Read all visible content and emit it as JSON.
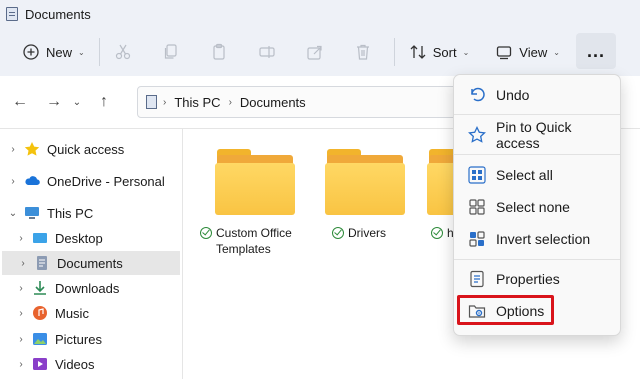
{
  "window": {
    "title": "Documents"
  },
  "toolbar": {
    "new_label": "New",
    "sort_label": "Sort",
    "view_label": "View",
    "more_label": "..."
  },
  "address": {
    "crumbs": [
      "This PC",
      "Documents"
    ]
  },
  "nav_pane": {
    "items": [
      {
        "label": "Quick access",
        "icon": "star-icon"
      },
      {
        "label": "OneDrive - Personal",
        "icon": "cloud-icon"
      },
      {
        "label": "This PC",
        "icon": "computer-icon"
      },
      {
        "label": "Desktop",
        "icon": "desktop-icon"
      },
      {
        "label": "Documents",
        "icon": "documents-icon"
      },
      {
        "label": "Downloads",
        "icon": "download-icon"
      },
      {
        "label": "Music",
        "icon": "music-icon"
      },
      {
        "label": "Pictures",
        "icon": "pictures-icon"
      },
      {
        "label": "Videos",
        "icon": "videos-icon"
      }
    ],
    "selected": "Documents"
  },
  "folders": [
    {
      "name_line1": "Custom Office",
      "name_line2": "Templates"
    },
    {
      "name_line1": "Drivers",
      "name_line2": ""
    },
    {
      "name_line1": "h",
      "name_line2": ""
    }
  ],
  "menu": {
    "items": [
      {
        "label": "Undo",
        "icon": "undo-icon"
      },
      {
        "label": "Pin to Quick access",
        "icon": "pin-icon"
      },
      {
        "label": "Select all",
        "icon": "select-all-icon"
      },
      {
        "label": "Select none",
        "icon": "select-none-icon"
      },
      {
        "label": "Invert selection",
        "icon": "invert-selection-icon"
      },
      {
        "label": "Properties",
        "icon": "properties-icon"
      },
      {
        "label": "Options",
        "icon": "options-icon"
      }
    ],
    "highlighted": "Options"
  },
  "colors": {
    "accent": "#2a6fc9",
    "highlight": "#d9141b",
    "toolbar_bg": "#eef1f7",
    "folder": "#f9c443"
  }
}
